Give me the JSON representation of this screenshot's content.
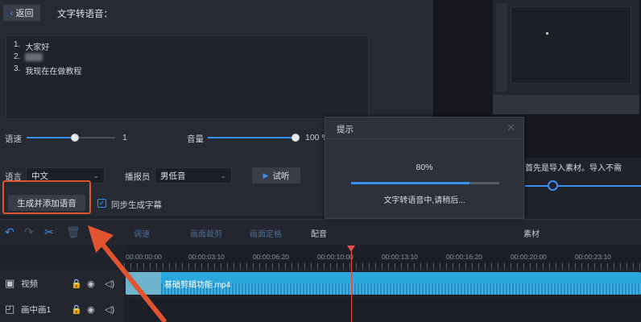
{
  "header": {
    "back_label": "返回",
    "title": "文字转语音："
  },
  "editor": {
    "line1_num": "1.",
    "line1": "大家好",
    "line2_num": "2.",
    "line3_num": "3.",
    "line3": "我现在在做教程"
  },
  "speed": {
    "label": "语速",
    "value": "1",
    "level": 0.5
  },
  "volume": {
    "label": "音量",
    "value": "100",
    "unit": "%",
    "level": 1.0
  },
  "language": {
    "label": "语言",
    "selected": "中文"
  },
  "speaker": {
    "label": "播报员",
    "selected": "男低音"
  },
  "trial_label": "试听",
  "generate_label": "生成并添加语音",
  "sync_subtitle": {
    "label": "同步生成字幕",
    "checked": true
  },
  "preview_notice": "首先是导入素材。导入不需",
  "dialog": {
    "title": "提示",
    "progress_text": "80%",
    "progress": 0.8,
    "message": "文字转语音中,请稍后..."
  },
  "toolbar": {
    "items": [
      "调速",
      "画面裁剪",
      "画面定格",
      "配音",
      "素材"
    ]
  },
  "ruler": {
    "ticks": [
      "00:00:00:00",
      "00:00:03:10",
      "00:00:06:20",
      "00:00:10:00",
      "00:00:13:10",
      "00:00:16:20",
      "00:00:20:00",
      "00:00:23:10"
    ]
  },
  "tracks": [
    {
      "name": "视频"
    },
    {
      "name": "画中画1"
    }
  ],
  "clip": {
    "name": "基础剪辑功能.mp4"
  },
  "colors": {
    "accent": "#3a8ff0",
    "highlight": "#e2532f",
    "clip": "#2aa8dc",
    "playhead": "#e84b4b"
  }
}
